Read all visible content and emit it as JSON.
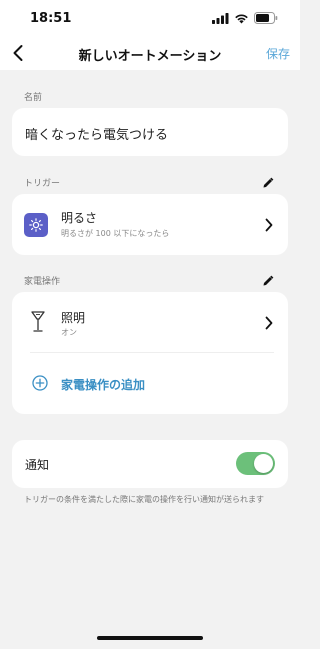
{
  "status_bar": {
    "time": "18:51",
    "icons": [
      "cellular-signal-icon",
      "wifi-icon",
      "battery-icon"
    ]
  },
  "nav": {
    "back_icon": "chevron-left-icon",
    "title": "新しいオートメーション",
    "save_label": "保存"
  },
  "name_section": {
    "label": "名前",
    "value": "暗くなったら電気つける"
  },
  "trigger_section": {
    "label": "トリガー",
    "edit_icon": "pencil-icon",
    "item": {
      "icon": "brightness-sun-icon",
      "title": "明るさ",
      "subtitle": "明るさが 100 以下になったら"
    }
  },
  "appliance_section": {
    "label": "家電操作",
    "edit_icon": "pencil-icon",
    "item": {
      "icon": "floor-lamp-icon",
      "title": "照明",
      "subtitle": "オン"
    },
    "add_label": "家電操作の追加"
  },
  "notification_section": {
    "label": "通知",
    "enabled": true,
    "description": "トリガーの条件を満たした際に家電の操作を行い通知が送られます"
  },
  "colors": {
    "accent": "#3a8fc4",
    "save": "#5aa7d8",
    "toggle_on": "#6cc07a",
    "trigger_icon_bg": "#5b5fc7",
    "background": "#f2f2f2",
    "card": "#ffffff"
  }
}
